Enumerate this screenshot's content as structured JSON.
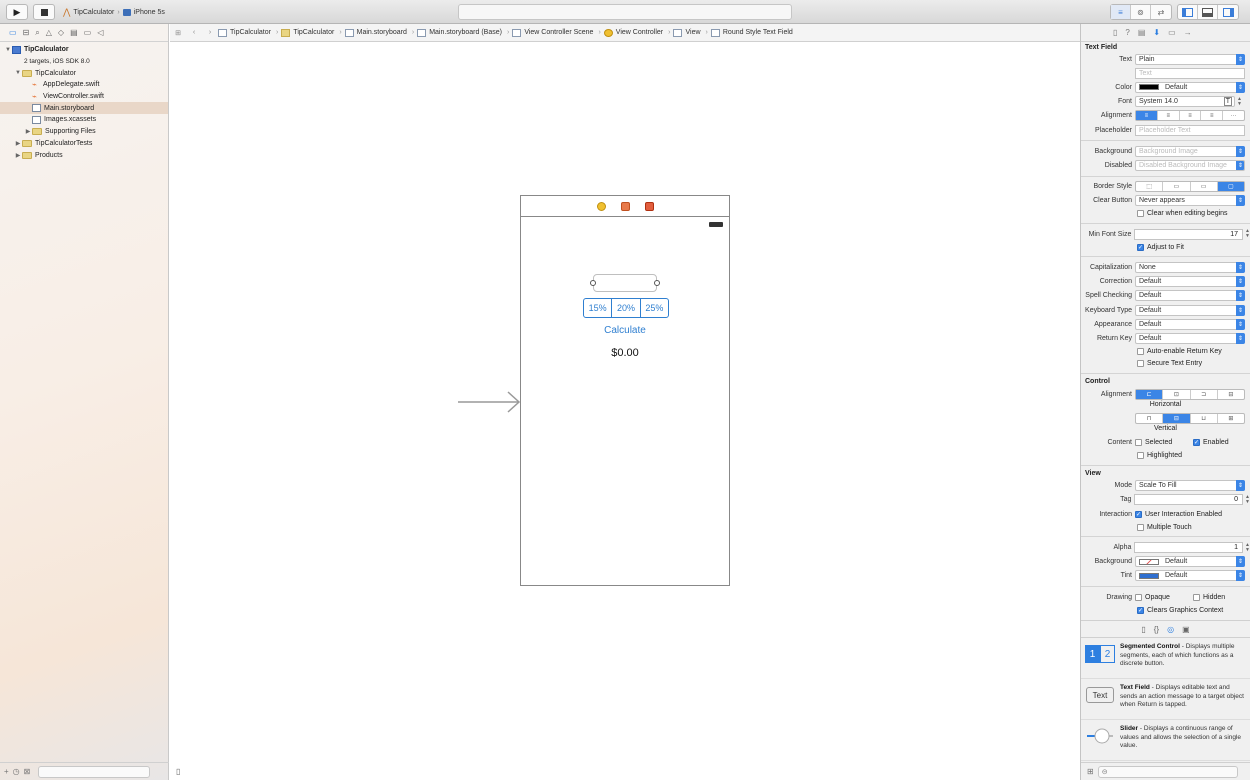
{
  "toolbar": {
    "scheme_name": "TipCalculator",
    "device_name": "iPhone 5s"
  },
  "navigator": {
    "tree": [
      {
        "label": "TipCalculator",
        "indent": 0,
        "disclosure": "▼",
        "icon": "project-icon",
        "bold": true
      },
      {
        "label": "2 targets, iOS SDK 8.0",
        "indent": 0,
        "disclosure": "",
        "icon": "",
        "sub": true
      },
      {
        "label": "TipCalculator",
        "indent": 1,
        "disclosure": "▼",
        "icon": "folder-icon"
      },
      {
        "label": "AppDelegate.swift",
        "indent": 2,
        "disclosure": "",
        "icon": "swift-file-icon"
      },
      {
        "label": "ViewController.swift",
        "indent": 2,
        "disclosure": "",
        "icon": "swift-file-icon"
      },
      {
        "label": "Main.storyboard",
        "indent": 2,
        "disclosure": "",
        "icon": "storyboard-icon",
        "selected": true
      },
      {
        "label": "Images.xcassets",
        "indent": 2,
        "disclosure": "",
        "icon": "assets-icon"
      },
      {
        "label": "Supporting Files",
        "indent": 2,
        "disclosure": "▶",
        "icon": "folder-icon"
      },
      {
        "label": "TipCalculatorTests",
        "indent": 1,
        "disclosure": "▶",
        "icon": "folder-icon"
      },
      {
        "label": "Products",
        "indent": 1,
        "disclosure": "▶",
        "icon": "folder-icon"
      }
    ]
  },
  "jumpbar": {
    "crumbs": [
      "TipCalculator",
      "TipCalculator",
      "Main.storyboard",
      "Main.storyboard (Base)",
      "View Controller Scene",
      "View Controller",
      "View",
      "Round Style Text Field"
    ]
  },
  "canvas": {
    "segments": [
      "15%",
      "20%",
      "25%"
    ],
    "calculate_label": "Calculate",
    "total_label": "$0.00"
  },
  "inspector": {
    "text_field_title": "Text Field",
    "text": {
      "label": "Text",
      "value": "Plain",
      "placeholder": "Text"
    },
    "color": {
      "label": "Color",
      "value": "Default",
      "swatch": "#000000"
    },
    "font": {
      "label": "Font",
      "value": "System 14.0"
    },
    "alignment_label": "Alignment",
    "placeholder": {
      "label": "Placeholder",
      "value": "Placeholder Text"
    },
    "background": {
      "label": "Background",
      "value": "Background Image"
    },
    "disabled": {
      "label": "Disabled",
      "value": "Disabled Background Image"
    },
    "border_style_label": "Border Style",
    "clear_button": {
      "label": "Clear Button",
      "value": "Never appears"
    },
    "clear_when_editing": "Clear when editing begins",
    "min_font_size": {
      "label": "Min Font Size",
      "value": "17"
    },
    "adjust_to_fit": "Adjust to Fit",
    "capitalization": {
      "label": "Capitalization",
      "value": "None"
    },
    "correction": {
      "label": "Correction",
      "value": "Default"
    },
    "spell_checking": {
      "label": "Spell Checking",
      "value": "Default"
    },
    "keyboard_type": {
      "label": "Keyboard Type",
      "value": "Default"
    },
    "appearance": {
      "label": "Appearance",
      "value": "Default"
    },
    "return_key": {
      "label": "Return Key",
      "value": "Default"
    },
    "auto_enable": "Auto-enable Return Key",
    "secure_entry": "Secure Text Entry",
    "control_title": "Control",
    "control_alignment_label": "Alignment",
    "horizontal_caption": "Horizontal",
    "vertical_caption": "Vertical",
    "content_label": "Content",
    "selected": "Selected",
    "enabled": "Enabled",
    "highlighted": "Highlighted",
    "view_title": "View",
    "mode": {
      "label": "Mode",
      "value": "Scale To Fill"
    },
    "tag": {
      "label": "Tag",
      "value": "0"
    },
    "interaction_label": "Interaction",
    "user_interaction": "User Interaction Enabled",
    "multiple_touch": "Multiple Touch",
    "alpha": {
      "label": "Alpha",
      "value": "1"
    },
    "view_background": {
      "label": "Background",
      "value": "Default"
    },
    "tint": {
      "label": "Tint",
      "value": "Default",
      "swatch": "#2f6fd0"
    },
    "drawing_label": "Drawing",
    "opaque": "Opaque",
    "hidden": "Hidden",
    "clears_graphics": "Clears Graphics Context"
  },
  "library": {
    "items": [
      {
        "icon_text": "",
        "title": "Segmented Control",
        "desc": " - Displays multiple segments, each of which functions as a discrete button."
      },
      {
        "icon_text": "Text",
        "title": "Text Field",
        "desc": " - Displays editable text and sends an action message to a target object when Return is tapped."
      },
      {
        "icon_text": "",
        "title": "Slider",
        "desc": " - Displays a continuous range of values and allows the selection of a single value."
      }
    ],
    "seg_icon_1": "1",
    "seg_icon_2": "2"
  },
  "colors": {
    "accent": "#2f7fd0",
    "selection": "#e9d7c8"
  }
}
